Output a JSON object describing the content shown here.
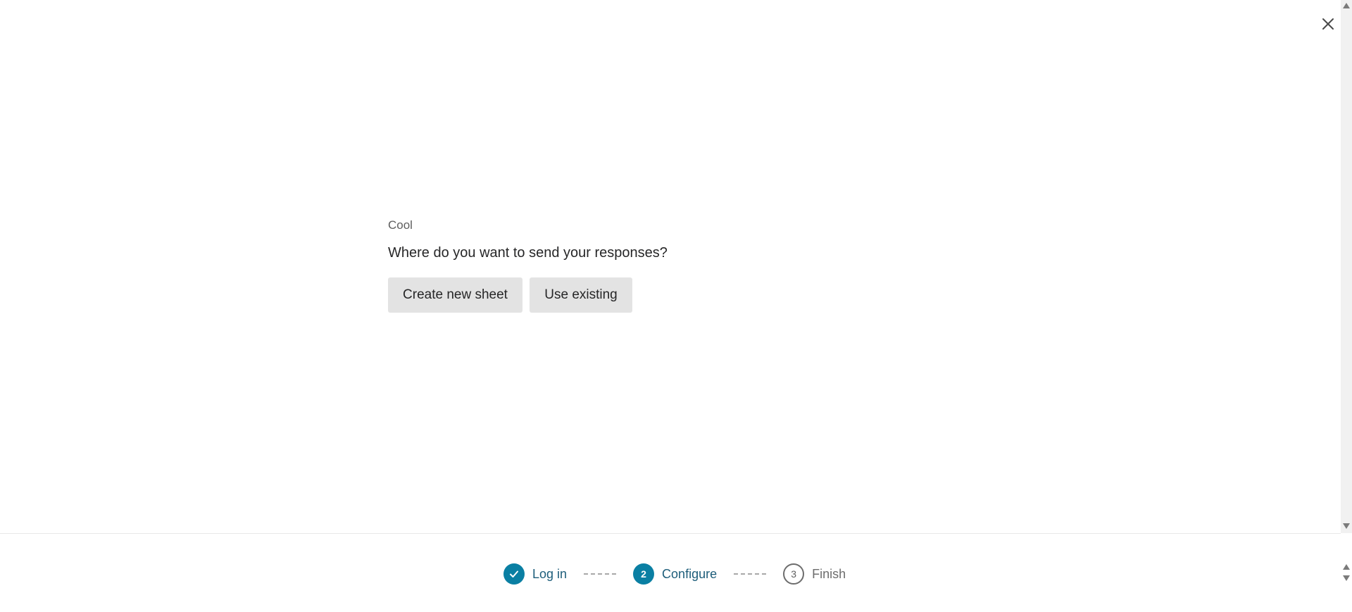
{
  "dialog": {
    "close_icon": "close-icon"
  },
  "content": {
    "eyebrow": "Cool",
    "question": "Where do you want to send your responses?",
    "buttons": [
      {
        "label": "Create new sheet"
      },
      {
        "label": "Use existing"
      }
    ]
  },
  "stepper": {
    "steps": [
      {
        "label": "Log in",
        "state": "done",
        "icon": "checkmark-icon"
      },
      {
        "number": "2",
        "label": "Configure",
        "state": "current"
      },
      {
        "number": "3",
        "label": "Finish",
        "state": "upcoming"
      }
    ]
  },
  "colors": {
    "accent": "#0a7fa3",
    "step_text_active": "#1d5d7a",
    "button_bg": "#e3e3e3"
  }
}
